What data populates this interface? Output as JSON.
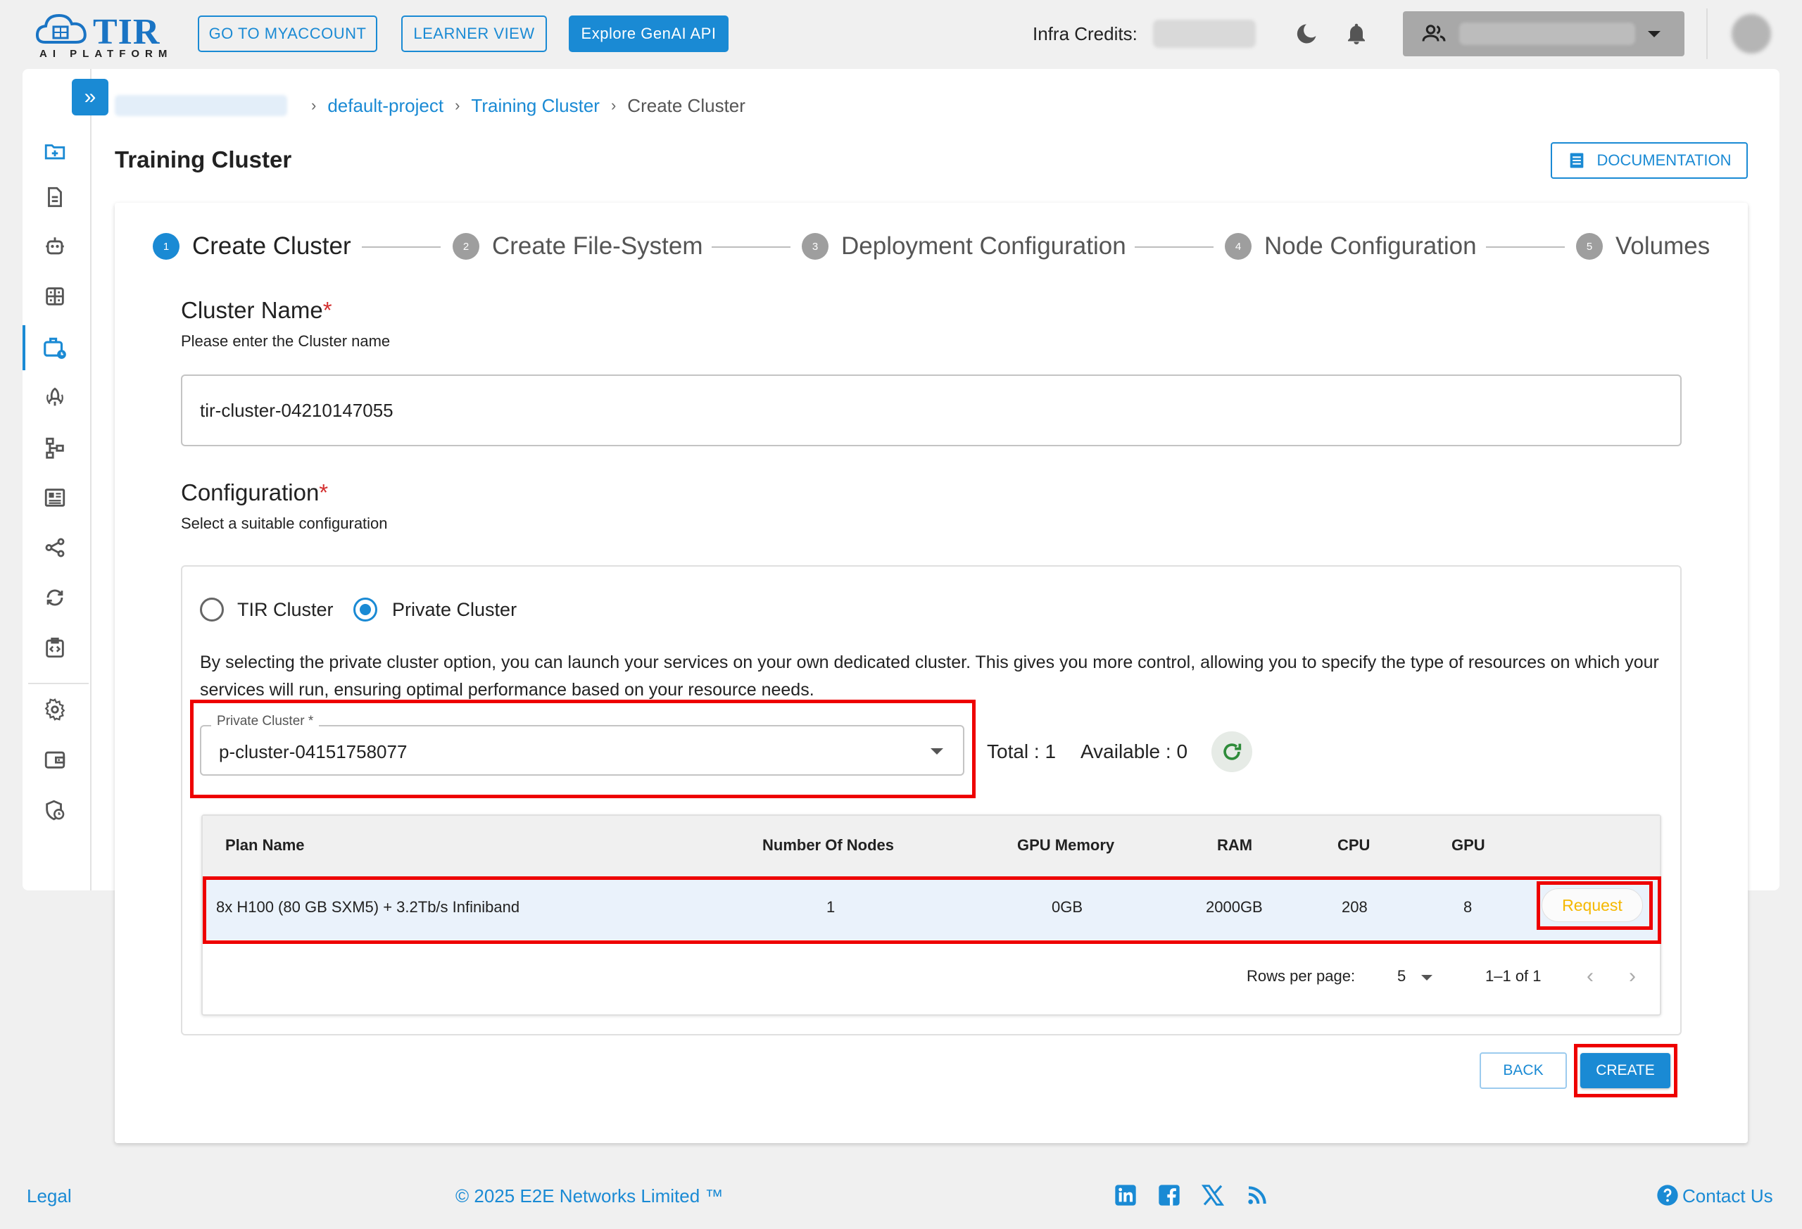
{
  "header": {
    "logo_text": "TIR",
    "logo_sub": "AI PLATFORM",
    "buttons": [
      "GO TO MYACCOUNT",
      "LEARNER VIEW",
      "Explore GenAI API"
    ],
    "credits_label": "Infra Credits:",
    "icons": [
      "moon-icon",
      "bell-icon",
      "users-icon",
      "chevron-down-icon"
    ]
  },
  "sidebar": {
    "toggle": "»",
    "icons": [
      "folder-plus-icon",
      "document-icon",
      "robot-icon",
      "grid-icon",
      "cluster-icon",
      "rocket-icon",
      "hierarchy-icon",
      "dashboard-icon",
      "share-icon",
      "sync-icon",
      "code-clipboard-icon",
      "gear-icon",
      "wallet-icon",
      "shield-clock-icon"
    ]
  },
  "breadcrumb": {
    "items": [
      "default-project",
      "Training Cluster",
      "Create Cluster"
    ]
  },
  "page": {
    "title": "Training Cluster",
    "doc_button": "DOCUMENTATION"
  },
  "stepper": {
    "steps": [
      {
        "num": "1",
        "label": "Create Cluster"
      },
      {
        "num": "2",
        "label": "Create File-System"
      },
      {
        "num": "3",
        "label": "Deployment Configuration"
      },
      {
        "num": "4",
        "label": "Node Configuration"
      },
      {
        "num": "5",
        "label": "Volumes"
      }
    ]
  },
  "form": {
    "cluster_name_title": "Cluster Name",
    "cluster_name_sub": "Please enter the Cluster name",
    "cluster_name_value": "tir-cluster-04210147055",
    "config_title": "Configuration",
    "config_sub": "Select a suitable configuration",
    "required_mark": "*",
    "radio_tir": "TIR Cluster",
    "radio_private": "Private Cluster",
    "selected_radio": "Private Cluster",
    "description": "By selecting the private cluster option, you can launch your services on your own dedicated cluster. This gives you more control, allowing you to specify the type of resources on which your services will run, ensuring optimal performance based on your resource needs.",
    "private_cluster_label": "Private Cluster *",
    "private_cluster_value": "p-cluster-04151758077",
    "total": "Total : 1",
    "available": "Available : 0"
  },
  "table": {
    "headers": [
      "Plan Name",
      "Number Of Nodes",
      "GPU Memory",
      "RAM",
      "CPU",
      "GPU"
    ],
    "rows": [
      {
        "plan": "8x H100 (80 GB SXM5) + 3.2Tb/s Infiniband",
        "nodes": "1",
        "gpu_memory": "0GB",
        "ram": "2000GB",
        "cpu": "208",
        "gpu": "8",
        "action": "Request"
      }
    ],
    "rows_per_page_label": "Rows per page:",
    "rows_per_page_value": "5",
    "range": "1–1 of 1"
  },
  "actions": {
    "back": "BACK",
    "create": "CREATE"
  },
  "footer": {
    "legal": "Legal",
    "copyright": "© 2025 E2E Networks Limited ™",
    "contact": "Contact Us",
    "social_icons": [
      "linkedin-icon",
      "facebook-icon",
      "x-icon",
      "rss-icon"
    ]
  },
  "colors": {
    "accent": "#1a8ad4",
    "highlight_border": "#ee0000",
    "request_text": "#f5b800"
  }
}
